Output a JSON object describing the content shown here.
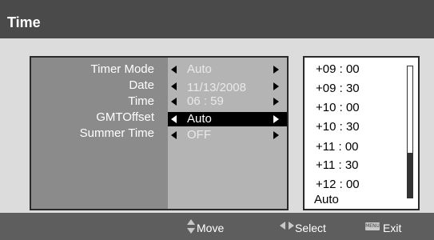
{
  "window": {
    "title": "Time"
  },
  "settings": [
    {
      "label": "Timer Mode",
      "value": "Auto",
      "selected": false
    },
    {
      "label": "Date",
      "value": "11/13/2008",
      "selected": false
    },
    {
      "label": "Time",
      "value": "06 : 59",
      "selected": false
    },
    {
      "label": "GMTOffset",
      "value": "Auto",
      "selected": true
    },
    {
      "label": "Summer Time",
      "value": "OFF",
      "selected": false
    }
  ],
  "gmt_options": [
    "+09 : 00",
    "+09 : 30",
    "+10 : 00",
    "+10 : 30",
    "+11 : 00",
    "+11 : 30",
    "+12 : 00",
    "Auto"
  ],
  "footer": {
    "move": "Move",
    "select": "Select",
    "menu_badge": "MENU",
    "exit": "Exit"
  },
  "icons": {
    "move": "up-down-arrows-icon",
    "select": "left-right-arrows-icon",
    "exit": "menu-key-icon"
  }
}
